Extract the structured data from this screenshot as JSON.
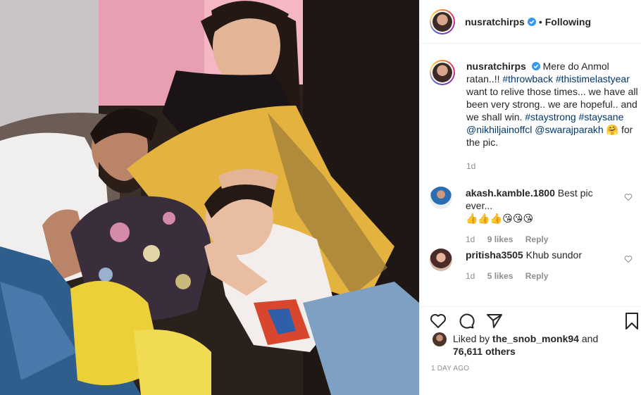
{
  "post": {
    "username": "nusratchirps",
    "follow_status": "Following",
    "separator": "•",
    "caption": {
      "username": "nusratchirps",
      "text_1": "Mere do Anmol ratan..!!",
      "tag_1": "#throwback",
      "tag_2": "#thistimelastyear",
      "text_2": "want to relive those times... we have all been very strong.. we are hopeful.. and we shall win.",
      "tag_3": "#staystrong",
      "tag_4": "#staysane",
      "tag_5": "@nikhiljainoffcl",
      "tag_6": "@swarajparakh",
      "emoji": "🤗",
      "text_3": "for the pic.",
      "age": "1d"
    },
    "comments": [
      {
        "username": "akash.kamble.1800",
        "text_1": "Best pic ever...",
        "text_2": "👍👍👍😘😘😘",
        "age": "1d",
        "likes": "9 likes",
        "reply": "Reply"
      },
      {
        "username": "pritisha3505",
        "text_1": "Khub sundor",
        "text_2": "",
        "age": "1d",
        "likes": "5 likes",
        "reply": "Reply"
      }
    ],
    "likes": {
      "prefix": "Liked by",
      "user": "the_snob_monk94",
      "and": "and",
      "count": "76,611 others"
    },
    "date": "1 DAY AGO",
    "icons": [
      "heart-icon",
      "comment-icon",
      "share-icon",
      "bookmark-icon",
      "verified-icon"
    ],
    "colors": {
      "link": "#00376b",
      "muted": "#8e8e8e",
      "verified": "#3897f0"
    }
  }
}
